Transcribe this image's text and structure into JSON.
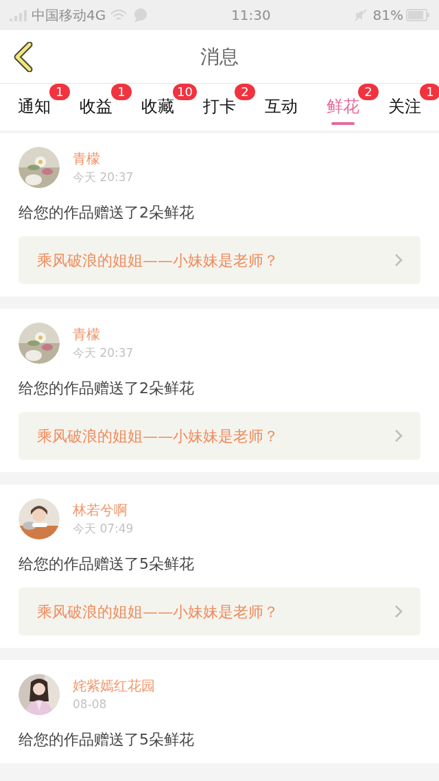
{
  "status_bar": {
    "carrier": "中国移动4G",
    "time": "11:30",
    "battery": "81%"
  },
  "header": {
    "title": "消息"
  },
  "tabs": [
    {
      "label": "通知",
      "badge": "1",
      "selected": false
    },
    {
      "label": "收益",
      "badge": "1",
      "selected": false
    },
    {
      "label": "收藏",
      "badge": "10",
      "selected": false
    },
    {
      "label": "打卡",
      "badge": "2",
      "selected": false
    },
    {
      "label": "互动",
      "selected": false
    },
    {
      "label": "鲜花",
      "badge": "2",
      "selected": true
    },
    {
      "label": "关注",
      "badge": "1",
      "selected": false
    }
  ],
  "messages": [
    {
      "name": "青檬",
      "time": "今天 20:37",
      "text": "给您的作品赠送了2朵鲜花",
      "link": "乘风破浪的姐姐——小妹妹是老师？"
    },
    {
      "name": "青檬",
      "time": "今天 20:37",
      "text": "给您的作品赠送了2朵鲜花",
      "link": "乘风破浪的姐姐——小妹妹是老师？"
    },
    {
      "name": "林若兮啊",
      "time": "今天 07:49",
      "text": "给您的作品赠送了5朵鲜花",
      "link": "乘风破浪的姐姐——小妹妹是老师？"
    },
    {
      "name": "姹紫嫣红花园",
      "time": "08-08",
      "text": "给您的作品赠送了5朵鲜花"
    }
  ]
}
